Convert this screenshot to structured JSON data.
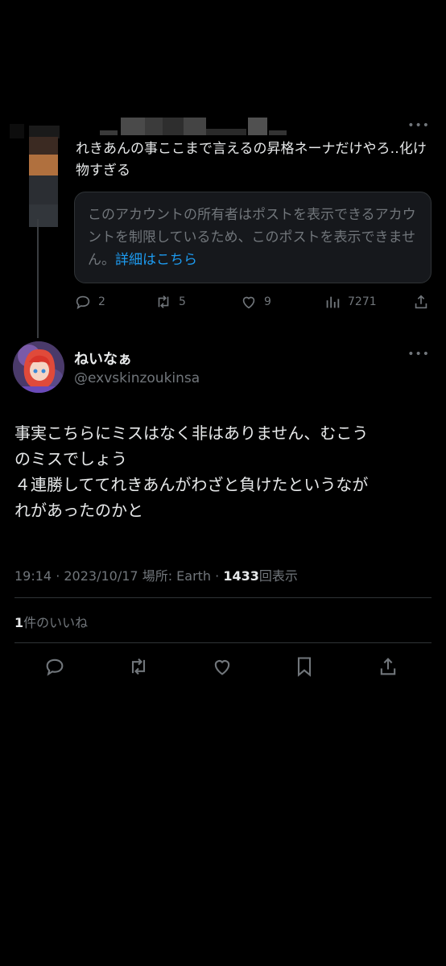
{
  "parent_post": {
    "text": "れきあんの事ここまで言えるの昇格ネーナだけやろ‥化け物すぎる",
    "notice_text": "このアカウントの所有者はポストを表示できるアカウントを制限しているため、このポストを表示できません。",
    "notice_link": "詳細はこちら",
    "more_label": "•••",
    "stats": {
      "replies": "2",
      "reposts": "5",
      "likes": "9",
      "views": "7271"
    }
  },
  "main_post": {
    "display_name": "ねいなぁ",
    "handle": "@exvskinzoukinsa",
    "more_label": "•••",
    "text_lines": [
      "事実こちらにミスはなく非はありません、むこう",
      "のミスでしょう",
      "４連勝しててれきあんがわざと負けたというなが",
      "れがあったのかと"
    ],
    "meta": {
      "time": "19:14",
      "date": "2023/10/17",
      "location_label": "場所: Earth",
      "views_count": "1433",
      "views_label": "回表示"
    },
    "likes": {
      "count": "1",
      "label": "件のいいね"
    }
  },
  "colors": {
    "background": "#000000",
    "text": "#e7e9ea",
    "muted": "#71767b",
    "link": "#1d9bf0",
    "card_bg": "#16181c",
    "border": "#2f3336"
  },
  "icons": [
    "reply-icon",
    "repost-icon",
    "like-icon",
    "views-icon",
    "share-icon",
    "bookmark-icon",
    "more-icon"
  ]
}
